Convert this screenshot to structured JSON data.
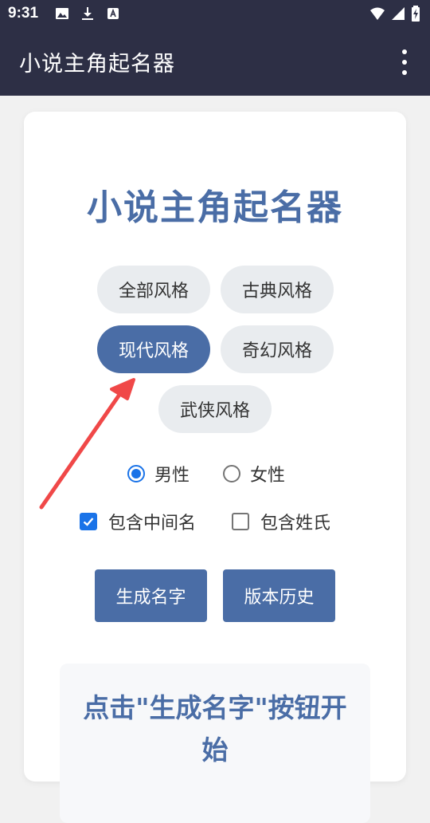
{
  "status_bar": {
    "time": "9:31",
    "left_icons": [
      "image-icon",
      "download-icon",
      "font-icon"
    ],
    "right_icons": [
      "wifi-icon",
      "signal-icon",
      "battery-charging-icon"
    ]
  },
  "app_bar": {
    "title": "小说主角起名器",
    "menu_icon": "more-vert-icon"
  },
  "main": {
    "title": "小说主角起名器",
    "styles": [
      {
        "label": "全部风格",
        "active": false
      },
      {
        "label": "古典风格",
        "active": false
      },
      {
        "label": "现代风格",
        "active": true
      },
      {
        "label": "奇幻风格",
        "active": false
      },
      {
        "label": "武侠风格",
        "active": false
      }
    ],
    "gender": [
      {
        "label": "男性",
        "checked": true
      },
      {
        "label": "女性",
        "checked": false
      }
    ],
    "options": [
      {
        "label": "包含中间名",
        "checked": true
      },
      {
        "label": "包含姓氏",
        "checked": false
      }
    ],
    "buttons": {
      "generate": "生成名字",
      "history": "版本历史"
    },
    "result_text": "点击\"生成名字\"按钮开始"
  },
  "colors": {
    "app_bar": "#2d2f45",
    "accent": "#4a6da6",
    "radio_check": "#1a73e8",
    "annotation_arrow": "#f04848"
  }
}
